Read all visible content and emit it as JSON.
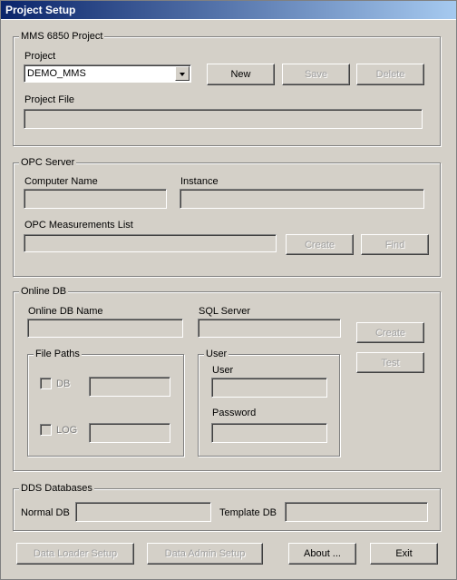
{
  "window": {
    "title": "Project Setup"
  },
  "mms_project": {
    "group_label": "MMS 6850 Project",
    "project_label": "Project",
    "project_value": "DEMO_MMS",
    "new_button": "New",
    "save_button": "Save",
    "delete_button": "Delete",
    "project_file_label": "Project File",
    "project_file_value": ""
  },
  "opc_server": {
    "group_label": "OPC Server",
    "computer_name_label": "Computer Name",
    "computer_name_value": "",
    "instance_label": "Instance",
    "instance_value": "",
    "measurements_label": "OPC Measurements List",
    "measurements_value": "",
    "create_button": "Create",
    "find_button": "Find"
  },
  "online_db": {
    "group_label": "Online DB",
    "name_label": "Online DB Name",
    "name_value": "",
    "sql_server_label": "SQL Server",
    "sql_server_value": "",
    "create_button": "Create",
    "test_button": "Test",
    "file_paths": {
      "group_label": "File Paths",
      "db_label": "DB",
      "db_value": "",
      "log_label": "LOG",
      "log_value": ""
    },
    "user": {
      "group_label": "User",
      "user_label": "User",
      "user_value": "",
      "password_label": "Password",
      "password_value": ""
    }
  },
  "dds": {
    "group_label": "DDS Databases",
    "normal_label": "Normal DB",
    "normal_value": "",
    "template_label": "Template DB",
    "template_value": ""
  },
  "footer": {
    "data_loader_button": "Data Loader Setup",
    "data_admin_button": "Data Admin Setup",
    "about_button": "About ...",
    "exit_button": "Exit"
  }
}
